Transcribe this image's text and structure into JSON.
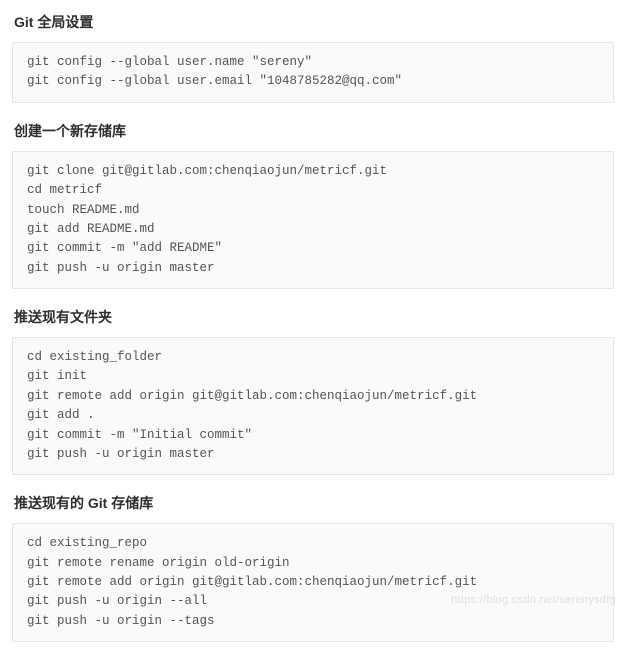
{
  "sections": [
    {
      "title": "Git 全局设置",
      "code": "git config --global user.name \"sereny\"\ngit config --global user.email \"1048785282@qq.com\""
    },
    {
      "title": "创建一个新存储库",
      "code": "git clone git@gitlab.com:chenqiaojun/metricf.git\ncd metricf\ntouch README.md\ngit add README.md\ngit commit -m \"add README\"\ngit push -u origin master"
    },
    {
      "title": "推送现有文件夹",
      "code": "cd existing_folder\ngit init\ngit remote add origin git@gitlab.com:chenqiaojun/metricf.git\ngit add .\ngit commit -m \"Initial commit\"\ngit push -u origin master"
    },
    {
      "title": "推送现有的 Git 存储库",
      "code": "cd existing_repo\ngit remote rename origin old-origin\ngit remote add origin git@gitlab.com:chenqiaojun/metricf.git\ngit push -u origin --all\ngit push -u origin --tags"
    }
  ],
  "watermark": "https://blog.csdn.net/serenysdfg"
}
